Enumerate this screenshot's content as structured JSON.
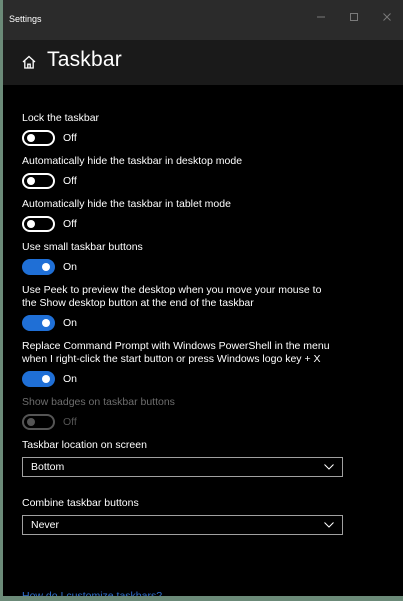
{
  "window": {
    "app_title": "Settings"
  },
  "header": {
    "title": "Taskbar",
    "icon": "home-icon"
  },
  "settings": [
    {
      "label": "Lock the taskbar",
      "state": "Off",
      "on": false,
      "disabled": false
    },
    {
      "label": "Automatically hide the taskbar in desktop mode",
      "state": "Off",
      "on": false,
      "disabled": false
    },
    {
      "label": "Automatically hide the taskbar in tablet mode",
      "state": "Off",
      "on": false,
      "disabled": false
    },
    {
      "label": "Use small taskbar buttons",
      "state": "On",
      "on": true,
      "disabled": false
    },
    {
      "label_line1": "Use Peek to preview the desktop when you move your mouse to",
      "label_line2": "the Show desktop button at the end of the taskbar",
      "state": "On",
      "on": true,
      "disabled": false
    },
    {
      "label_line1": "Replace Command Prompt with Windows PowerShell in the menu",
      "label_line2": "when I right-click the start button or press Windows logo key + X",
      "state": "On",
      "on": true,
      "disabled": false
    },
    {
      "label": "Show badges on taskbar buttons",
      "state": "Off",
      "on": false,
      "disabled": true
    }
  ],
  "location": {
    "label": "Taskbar location on screen",
    "value": "Bottom"
  },
  "combine": {
    "label": "Combine taskbar buttons",
    "value": "Never"
  },
  "help_link": "How do I customize taskbars?",
  "colors": {
    "accent": "#1f6fd6",
    "link": "#2f6fd0",
    "background": "#000000",
    "disabled": "#555555"
  }
}
